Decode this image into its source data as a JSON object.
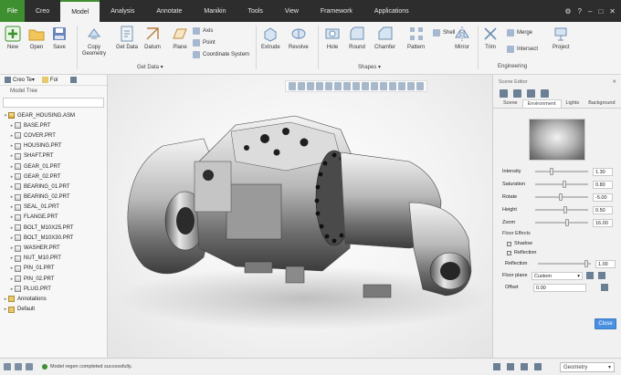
{
  "menu": {
    "file": "File",
    "tabs": [
      "Creo",
      "Model",
      "Analysis",
      "Annotate",
      "Manikin",
      "Tools",
      "View",
      "Framework",
      "Applications"
    ],
    "active_tab": "Model"
  },
  "ribbon": {
    "buttons": {
      "new": "New",
      "open": "Open",
      "save": "Save",
      "copy_geometry": "Copy Geometry",
      "get_data": "Get Data",
      "datum": "Datum",
      "plane": "Plane",
      "extrude": "Extrude",
      "revolve": "Revolve",
      "hole": "Hole",
      "round": "Round",
      "chamfer": "Chamfer",
      "pattern": "Pattern",
      "shell": "Shell",
      "mirror": "Mirror",
      "trim": "Trim",
      "merge": "Merge",
      "intersect": "Intersect",
      "project": "Project"
    },
    "small": {
      "axis": "Axis",
      "point": "Point",
      "coordinate_system": "Coordinate System"
    },
    "groups": {
      "get_data": "Get Data ▾",
      "shapes": "Shapes ▾",
      "engineering": "Engineering"
    }
  },
  "left_panel": {
    "tab_model": "Creo Te▾",
    "tab_other": "Fol",
    "title": "Model Tree",
    "search_placeholder": "",
    "tree": [
      {
        "label": "GEAR_HOUSING.ASM",
        "kind": "asm"
      },
      {
        "label": "BASE.PRT",
        "kind": "prt"
      },
      {
        "label": "COVER.PRT",
        "kind": "prt"
      },
      {
        "label": "HOUSING.PRT",
        "kind": "prt"
      },
      {
        "label": "SHAFT.PRT",
        "kind": "prt"
      },
      {
        "label": "GEAR_01.PRT",
        "kind": "prt"
      },
      {
        "label": "GEAR_02.PRT",
        "kind": "prt"
      },
      {
        "label": "BEARING_01.PRT",
        "kind": "prt"
      },
      {
        "label": "BEARING_02.PRT",
        "kind": "prt"
      },
      {
        "label": "SEAL_01.PRT",
        "kind": "prt"
      },
      {
        "label": "FLANGE.PRT",
        "kind": "prt"
      },
      {
        "label": "BOLT_M10X25.PRT",
        "kind": "prt"
      },
      {
        "label": "BOLT_M10X30.PRT",
        "kind": "prt"
      },
      {
        "label": "WASHER.PRT",
        "kind": "prt"
      },
      {
        "label": "NUT_M10.PRT",
        "kind": "prt"
      },
      {
        "label": "PIN_01.PRT",
        "kind": "prt"
      },
      {
        "label": "PIN_02.PRT",
        "kind": "prt"
      },
      {
        "label": "PLUG.PRT",
        "kind": "prt"
      },
      {
        "label": "Annotations",
        "kind": "fold"
      },
      {
        "label": "Default",
        "kind": "fold"
      }
    ]
  },
  "scene_editor": {
    "title": "Scene Editor",
    "tabs": [
      "Scene",
      "Environment",
      "Lights",
      "Background"
    ],
    "active_tab": "Environment",
    "params": [
      {
        "label": "Intensity",
        "value": "1.30",
        "level": 0.3
      },
      {
        "label": "Saturation",
        "value": "0.80",
        "level": 0.55
      },
      {
        "label": "Rotate",
        "value": "-5.00",
        "level": 0.48
      },
      {
        "label": "Height",
        "value": "0.50",
        "level": 0.58
      },
      {
        "label": "Zoom",
        "value": "16.00",
        "level": 0.62
      }
    ],
    "floor_effects": "Floor Effects",
    "shadow": "Shadow",
    "reflection_check": "Reflection",
    "reflection_label": "Reflection",
    "reflection_value": "1.00",
    "reflection_level": 0.95,
    "floor_plane_label": "Floor plane",
    "floor_plane_value": "Custom",
    "offset_label": "Offset",
    "offset_value": "0.00",
    "close": "Close"
  },
  "status": {
    "message": "Model regen completed successfully.",
    "filter": "Geometry"
  },
  "colors": {
    "accent": "#3d8f2f",
    "topbar": "#2d2d2d"
  }
}
